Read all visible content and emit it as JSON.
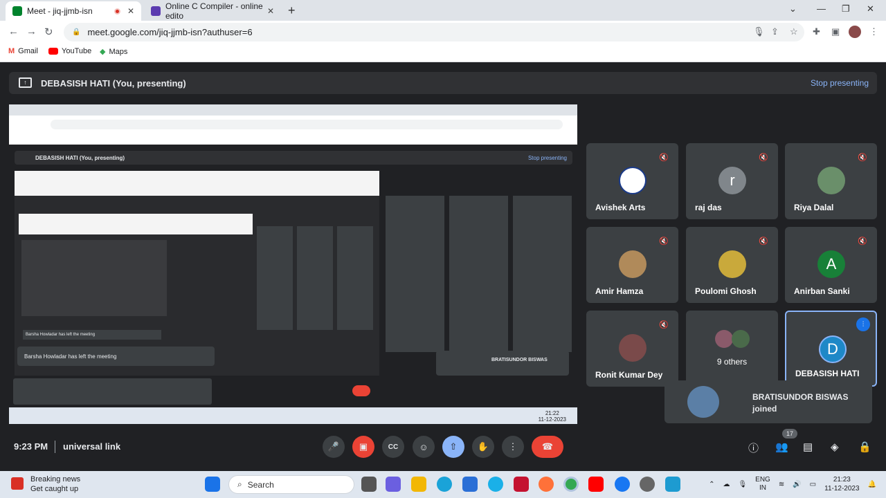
{
  "browser": {
    "tabs": [
      {
        "title": "Meet - jiq-jjmb-isn",
        "favicon_color": "#00832d"
      },
      {
        "title": "Online C Compiler - online edito",
        "favicon_color": "#5b3bb0"
      }
    ],
    "url": "meet.google.com/jiq-jjmb-isn?authuser=6",
    "bookmarks": [
      "Gmail",
      "YouTube",
      "Maps"
    ]
  },
  "meet": {
    "presenting_title": "DEBASISH HATI (You, presenting)",
    "stop_presenting": "Stop presenting",
    "participants": [
      {
        "name": "Avishek Arts",
        "avatar_letter": "",
        "avatar_color": "#ffffff",
        "muted": true
      },
      {
        "name": "raj das",
        "avatar_letter": "r",
        "avatar_color": "#80868b",
        "muted": true
      },
      {
        "name": "Riya Dalal",
        "avatar_letter": "",
        "avatar_color": "#6a8f6a",
        "muted": true
      },
      {
        "name": "Amir Hamza",
        "avatar_letter": "",
        "avatar_color": "#b08a5a",
        "muted": true
      },
      {
        "name": "Poulomi Ghosh",
        "avatar_letter": "",
        "avatar_color": "#c9a93b",
        "muted": true
      },
      {
        "name": "Anirban Sanki",
        "avatar_letter": "A",
        "avatar_color": "#188038",
        "muted": true
      },
      {
        "name": "Ronit Kumar Dey",
        "avatar_letter": "",
        "avatar_color": "#7a4a4a",
        "muted": true
      },
      {
        "name": "9 others",
        "avatar_letter": "",
        "avatar_color": "#4a6a4a",
        "muted": false
      },
      {
        "name": "DEBASISH HATI",
        "avatar_letter": "D",
        "avatar_color": "#1e88c7",
        "muted": false
      }
    ],
    "toast": {
      "name": "BRATISUNDOR BISWAS",
      "status": "joined"
    },
    "time": "9:23 PM",
    "meeting_code": "universal link",
    "people_count": "17"
  },
  "taskbar": {
    "news_title": "Breaking news",
    "news_sub": "Get caught up",
    "search_placeholder": "Search",
    "lang": "ENG",
    "region": "IN",
    "clock_time": "21:23",
    "clock_date": "11-12-2023"
  },
  "nested_capture": {
    "presenting_title": "DEBASISH HATI (You, presenting)",
    "stop_presenting": "Stop presenting",
    "left_meeting": "Barsha Howladar has left the meeting",
    "time": "21:22",
    "date": "11-12-2023"
  }
}
